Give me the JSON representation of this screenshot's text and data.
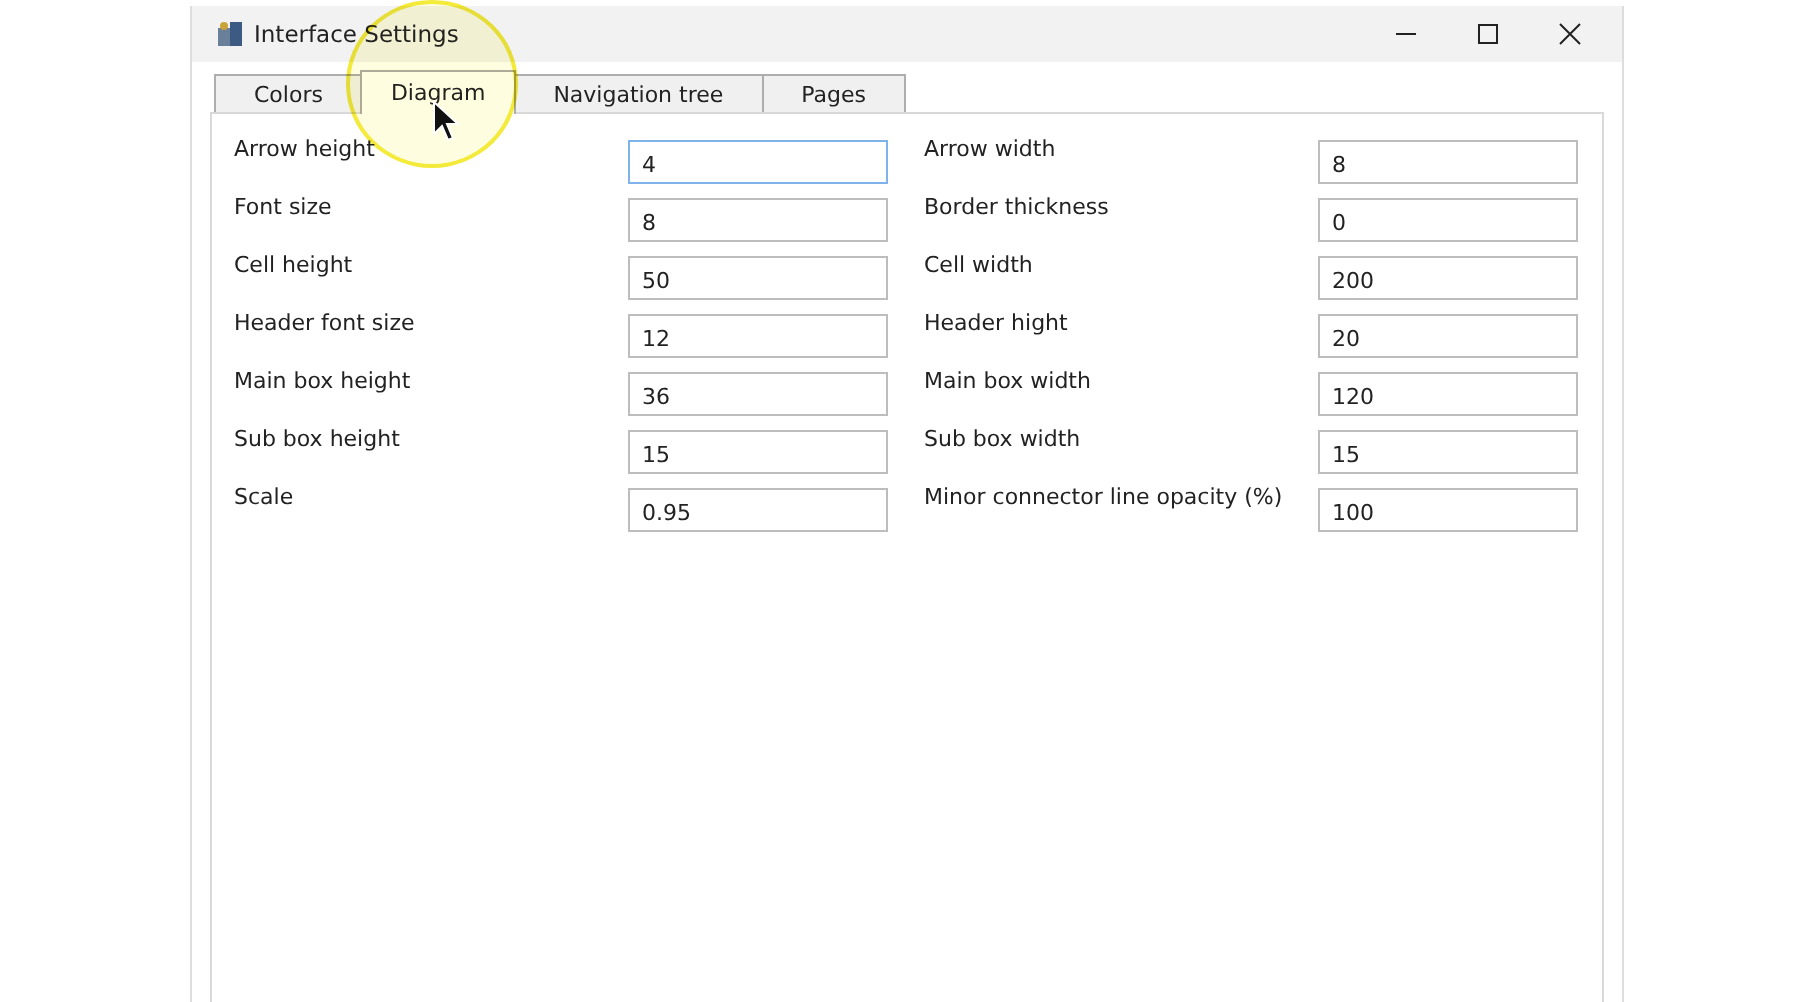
{
  "window": {
    "title": "Interface Settings"
  },
  "tabs": [
    {
      "label": "Colors",
      "selected": false
    },
    {
      "label": "Diagram",
      "selected": true
    },
    {
      "label": "Navigation tree",
      "selected": false
    },
    {
      "label": "Pages",
      "selected": false
    }
  ],
  "fields": [
    {
      "label": "Arrow height",
      "value": "4",
      "focused": true
    },
    {
      "label": "Arrow width",
      "value": "8",
      "focused": false
    },
    {
      "label": "Font size",
      "value": "8",
      "focused": false
    },
    {
      "label": "Border thickness",
      "value": "0",
      "focused": false
    },
    {
      "label": "Cell height",
      "value": "50",
      "focused": false
    },
    {
      "label": "Cell width",
      "value": "200",
      "focused": false
    },
    {
      "label": "Header font size",
      "value": "12",
      "focused": false
    },
    {
      "label": "Header hight",
      "value": "20",
      "focused": false
    },
    {
      "label": "Main box height",
      "value": "36",
      "focused": false
    },
    {
      "label": "Main box width",
      "value": "120",
      "focused": false
    },
    {
      "label": "Sub box height",
      "value": "15",
      "focused": false
    },
    {
      "label": "Sub box width",
      "value": "15",
      "focused": false
    },
    {
      "label": "Scale",
      "value": "0.95",
      "focused": false
    },
    {
      "label": "Minor connector line opacity (%)",
      "value": "100",
      "focused": false
    }
  ]
}
